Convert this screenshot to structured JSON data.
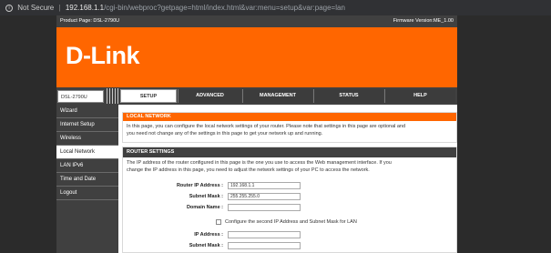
{
  "browser": {
    "security_label": "Not Secure",
    "url_host": "192.168.1.1",
    "url_path": "/cgi-bin/webproc?getpage=html/index.html&var:menu=setup&var:page=lan"
  },
  "header": {
    "product_page": "Product Page: DSL-2790U",
    "firmware": "Firmware Version:ME_1.00",
    "logo": "D-Link"
  },
  "nav": {
    "model": "DSL-2790U",
    "tabs": [
      {
        "label": "SETUP"
      },
      {
        "label": "ADVANCED"
      },
      {
        "label": "MANAGEMENT"
      },
      {
        "label": "STATUS"
      },
      {
        "label": "HELP"
      }
    ]
  },
  "sidebar": {
    "items": [
      {
        "label": "Wizard"
      },
      {
        "label": "Internet Setup"
      },
      {
        "label": "Wireless"
      },
      {
        "label": "Local Network"
      },
      {
        "label": "LAN IPv6"
      },
      {
        "label": "Time and Date"
      },
      {
        "label": "Logout"
      }
    ]
  },
  "local_network": {
    "title": "LOCAL NETWORK",
    "description_line1": "In this page, you can configure the local network settings of your router. Please note that settings in this page are optional and",
    "description_line2": "you need not change any of the settings in this page to get your network up and running."
  },
  "router_settings": {
    "title": "ROUTER SETTINGS",
    "description_line1": "The IP address of the router configured in this page is the one you use to access the Web management interface. If you",
    "description_line2": "change the IP address in this page, you need to adjust the network settings of your PC to access the network.",
    "ip_label": "Router IP Address :",
    "ip_value": "192.168.1.1",
    "mask_label": "Subnet Mask :",
    "mask_value": "255.255.255.0",
    "domain_label": "Domain Name :",
    "domain_value": "",
    "second_ip_checkbox_label": "Configure the second IP Address and Subnet Mask for LAN",
    "second_ip_label": "IP Address :",
    "second_ip_value": "",
    "second_mask_label": "Subnet Mask :",
    "second_mask_value": ""
  }
}
